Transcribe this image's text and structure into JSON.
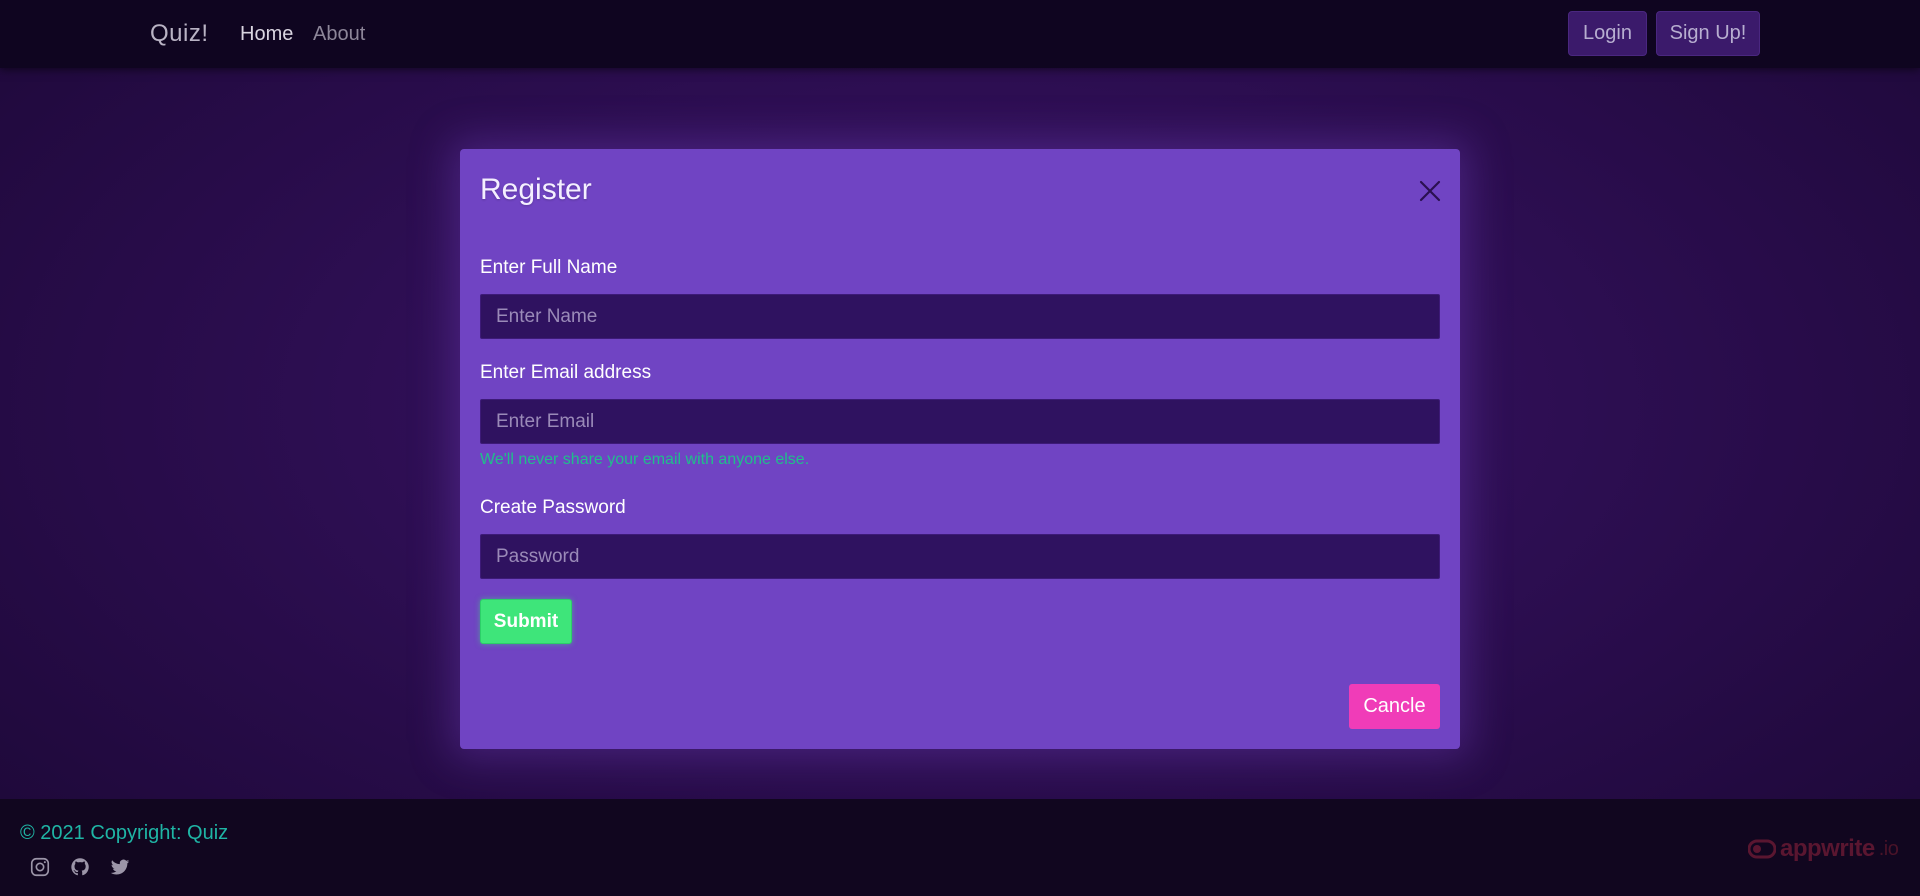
{
  "navbar": {
    "brand": "Quiz!",
    "links": [
      {
        "label": "Home"
      },
      {
        "label": "About"
      }
    ],
    "login_label": "Login",
    "signup_label": "Sign Up!"
  },
  "modal": {
    "title": "Register",
    "close_icon": "close-icon",
    "fields": {
      "name": {
        "label": "Enter Full Name",
        "placeholder": "Enter Name",
        "value": ""
      },
      "email": {
        "label": "Enter Email address",
        "placeholder": "Enter Email",
        "value": "",
        "help": "We'll never share your email with anyone else."
      },
      "password": {
        "label": "Create Password",
        "placeholder": "Password",
        "value": ""
      }
    },
    "submit_label": "Submit",
    "cancel_label": "Cancle"
  },
  "footer": {
    "copyright": "© 2021 Copyright: Quiz",
    "social_icons": [
      "instagram-icon",
      "github-icon",
      "twitter-icon"
    ],
    "badge": {
      "name": "appwrite",
      "suffix": ".io"
    }
  },
  "colors": {
    "accent_submit": "#3ee57a",
    "accent_cancel": "#f03cb8",
    "modal_bg": "#7044c3",
    "help_text": "#1fbf8a"
  }
}
